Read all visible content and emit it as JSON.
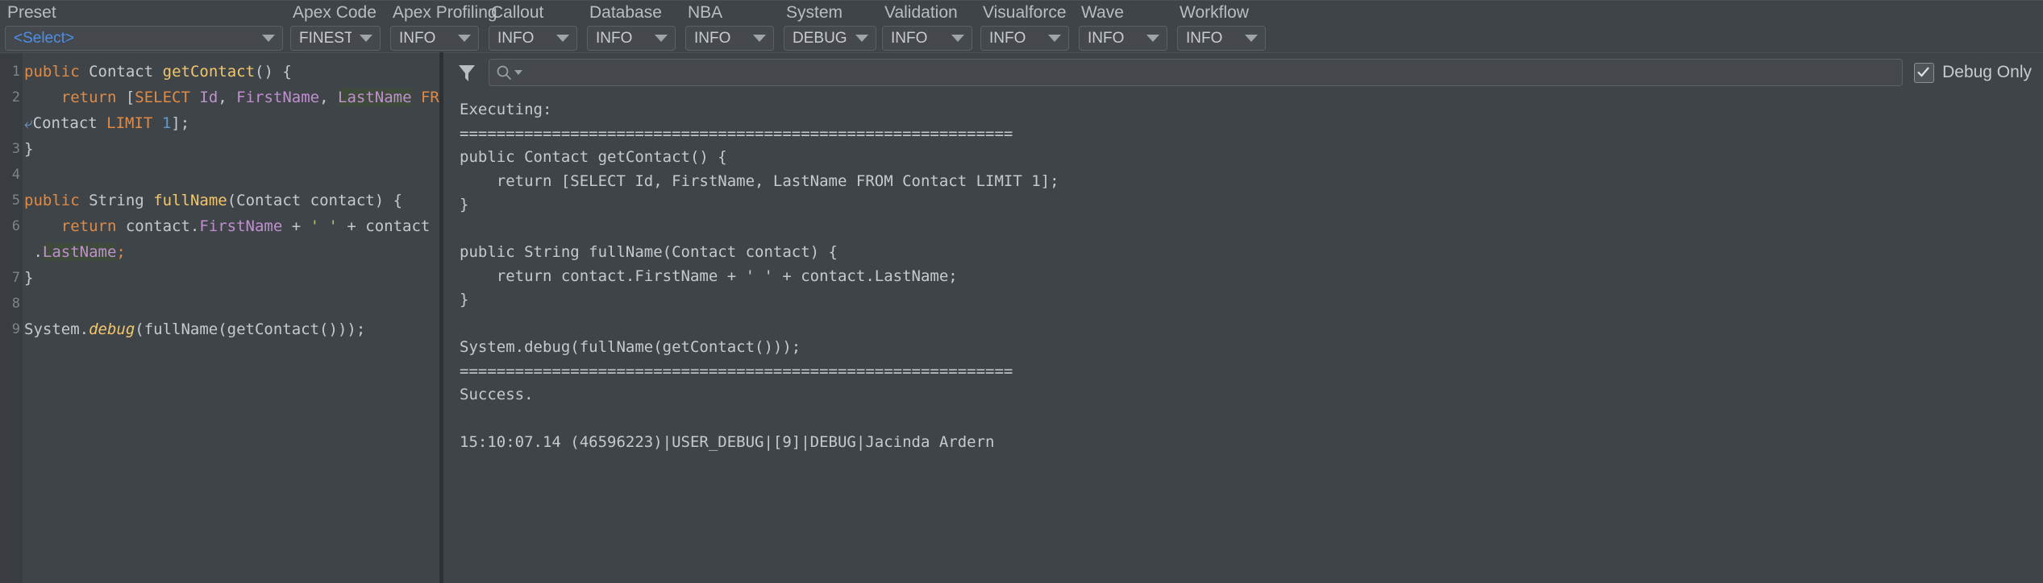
{
  "toolbar": {
    "fields": [
      {
        "label": "Preset",
        "value": "<Select>",
        "accent": true,
        "icon": "chevron-down-icon"
      },
      {
        "label": "Apex Code",
        "value": "FINEST",
        "accent": false,
        "icon": "chevron-down-icon"
      },
      {
        "label": "Apex Profiling",
        "value": "INFO",
        "accent": false,
        "icon": "chevron-down-icon"
      },
      {
        "label": "Callout",
        "value": "INFO",
        "accent": false,
        "icon": "chevron-down-icon"
      },
      {
        "label": "Database",
        "value": "INFO",
        "accent": false,
        "icon": "chevron-down-icon"
      },
      {
        "label": "NBA",
        "value": "INFO",
        "accent": false,
        "icon": "chevron-down-icon"
      },
      {
        "label": "System",
        "value": "DEBUG",
        "accent": false,
        "icon": "chevron-down-icon"
      },
      {
        "label": "Validation",
        "value": "INFO",
        "accent": false,
        "icon": "chevron-down-icon"
      },
      {
        "label": "Visualforce",
        "value": "INFO",
        "accent": false,
        "icon": "chevron-down-icon"
      },
      {
        "label": "Wave",
        "value": "INFO",
        "accent": false,
        "icon": "chevron-down-icon"
      },
      {
        "label": "Workflow",
        "value": "INFO",
        "accent": false,
        "icon": "chevron-down-icon"
      }
    ]
  },
  "editor": {
    "gutter": [
      "1",
      "2",
      "",
      "3",
      "4",
      "5",
      "6",
      "",
      "7",
      "8",
      "9"
    ],
    "lines": [
      [
        {
          "t": "public",
          "c": "k"
        },
        {
          "t": " ",
          "c": "pn"
        },
        {
          "t": "Contact",
          "c": "ty"
        },
        {
          "t": " ",
          "c": "pn"
        },
        {
          "t": "getContact",
          "c": "fn"
        },
        {
          "t": "() {",
          "c": "pn"
        }
      ],
      [
        {
          "t": "    ",
          "c": "pn"
        },
        {
          "t": "return",
          "c": "k"
        },
        {
          "t": " [",
          "c": "pn"
        },
        {
          "t": "SELECT",
          "c": "k"
        },
        {
          "t": " ",
          "c": "pn"
        },
        {
          "t": "Id",
          "c": "fld"
        },
        {
          "t": ", ",
          "c": "pn"
        },
        {
          "t": "FirstName",
          "c": "fld"
        },
        {
          "t": ", ",
          "c": "pn"
        },
        {
          "t": "LastName",
          "c": "fldh"
        },
        {
          "t": " ",
          "c": "pn"
        },
        {
          "t": "FROM",
          "c": "k"
        },
        {
          "t": " ",
          "c": "pn"
        },
        {
          "t": "⤶",
          "c": "wrapmark"
        }
      ],
      [
        {
          "t": "⤶",
          "c": "wrapmark"
        },
        {
          "t": "Contact ",
          "c": "ty"
        },
        {
          "t": "LIMIT",
          "c": "k"
        },
        {
          "t": " ",
          "c": "pn"
        },
        {
          "t": "1",
          "c": "num"
        },
        {
          "t": "];",
          "c": "pn"
        }
      ],
      [
        {
          "t": "}",
          "c": "pn"
        }
      ],
      [
        {
          "t": "",
          "c": "pn"
        }
      ],
      [
        {
          "t": "public",
          "c": "k"
        },
        {
          "t": " ",
          "c": "pn"
        },
        {
          "t": "String",
          "c": "ty"
        },
        {
          "t": " ",
          "c": "pn"
        },
        {
          "t": "fullName",
          "c": "fn"
        },
        {
          "t": "(",
          "c": "pn"
        },
        {
          "t": "Contact",
          "c": "ty"
        },
        {
          "t": " contact) {",
          "c": "pn"
        }
      ],
      [
        {
          "t": "    ",
          "c": "pn"
        },
        {
          "t": "return",
          "c": "k"
        },
        {
          "t": " contact.",
          "c": "pn"
        },
        {
          "t": "FirstName",
          "c": "fld"
        },
        {
          "t": " + ",
          "c": "pn"
        },
        {
          "t": "' '",
          "c": "str"
        },
        {
          "t": " + contact",
          "c": "pn"
        }
      ],
      [
        {
          "t": " .",
          "c": "pn"
        },
        {
          "t": "LastName",
          "c": "fldh"
        },
        {
          "t": ";",
          "c": "k"
        }
      ],
      [
        {
          "t": "}",
          "c": "pn"
        }
      ],
      [
        {
          "t": "",
          "c": "pn"
        }
      ],
      [
        {
          "t": "System.",
          "c": "pn"
        },
        {
          "t": "debug",
          "c": "fni"
        },
        {
          "t": "(fullName(getContact()));",
          "c": "pn"
        }
      ]
    ]
  },
  "log_panel": {
    "filter_icon": "funnel-icon",
    "search": {
      "placeholder": "",
      "value": "",
      "icon": "search-icon",
      "dropdown_icon": "caret-down-icon"
    },
    "debug_only": {
      "label": "Debug Only",
      "checked": true
    },
    "lines": [
      "Executing:",
      "============================================================",
      "public Contact getContact() {",
      "    return [SELECT Id, FirstName, LastName FROM Contact LIMIT 1];",
      "}",
      "",
      "public String fullName(Contact contact) {",
      "    return contact.FirstName + ' ' + contact.LastName;",
      "}",
      "",
      "System.debug(fullName(getContact()));",
      "============================================================",
      "Success.",
      "",
      "15:10:07.14 (46596223)|USER_DEBUG|[9]|DEBUG|Jacinda Ardern"
    ]
  },
  "colors": {
    "background": "#3f4448",
    "gutter": "#393d41",
    "accent_blue": "#4d8fe8",
    "keyword_orange": "#e08a45",
    "method_yellow": "#f2c66d",
    "field_purple": "#c08fd0",
    "number_blue": "#5b9ad5",
    "string_olive": "#b5c06a",
    "text": "#c5cad0",
    "border": "#5a6064"
  }
}
